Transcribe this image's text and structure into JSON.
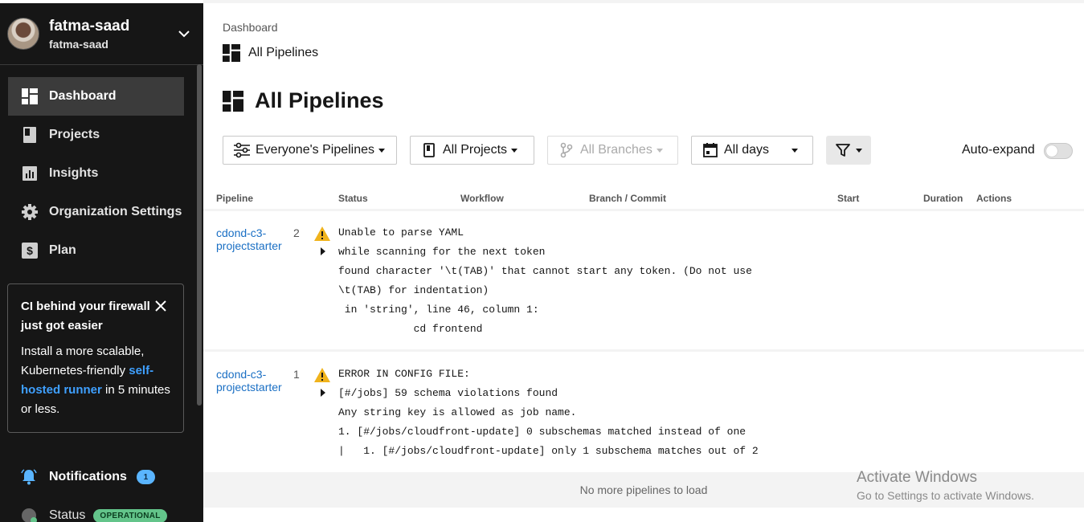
{
  "sidebar": {
    "org_name": "fatma-saad",
    "org_sub": "fatma-saad",
    "nav": [
      {
        "label": "Dashboard",
        "icon": "dashboard-icon",
        "active": true
      },
      {
        "label": "Projects",
        "icon": "projects-icon",
        "active": false
      },
      {
        "label": "Insights",
        "icon": "insights-icon",
        "active": false
      },
      {
        "label": "Organization Settings",
        "icon": "gear-icon",
        "active": false
      },
      {
        "label": "Plan",
        "icon": "dollar-icon",
        "active": false
      }
    ],
    "promo": {
      "title": "CI behind your firewall just got easier",
      "body_start": "Install a more scalable, Kubernetes-friendly ",
      "link": "self-hosted runner",
      "body_end": " in 5 minutes or less."
    },
    "notifications": {
      "label": "Notifications",
      "count": "1"
    },
    "status": {
      "label": "Status",
      "badge": "OPERATIONAL"
    }
  },
  "header": {
    "breadcrumb": "Dashboard",
    "sub_crumb": "All Pipelines",
    "title": "All Pipelines"
  },
  "filters": {
    "pipelines": "Everyone's Pipelines",
    "projects": "All Projects",
    "branches": "All Branches",
    "days": "All days",
    "auto_expand": "Auto-expand"
  },
  "table": {
    "headers": {
      "pipeline": "Pipeline",
      "status": "Status",
      "workflow": "Workflow",
      "branch": "Branch / Commit",
      "start": "Start",
      "duration": "Duration",
      "actions": "Actions"
    },
    "rows": [
      {
        "name": "cdond-c3-projectstarter",
        "number": "2",
        "error": "Unable to parse YAML\nwhile scanning for the next token\nfound character '\\t(TAB)' that cannot start any token. (Do not use\n\\t(TAB) for indentation)\n in 'string', line 46, column 1:\n            cd frontend"
      },
      {
        "name": "cdond-c3-projectstarter",
        "number": "1",
        "error": "ERROR IN CONFIG FILE:\n[#/jobs] 59 schema violations found\nAny string key is allowed as job name.\n1. [#/jobs/cloudfront-update] 0 subschemas matched instead of one\n|   1. [#/jobs/cloudfront-update] only 1 subschema matches out of 2"
      }
    ],
    "no_more": "No more pipelines to load"
  },
  "watermark": {
    "line1": "Activate Windows",
    "line2": "Go to Settings to activate Windows."
  }
}
